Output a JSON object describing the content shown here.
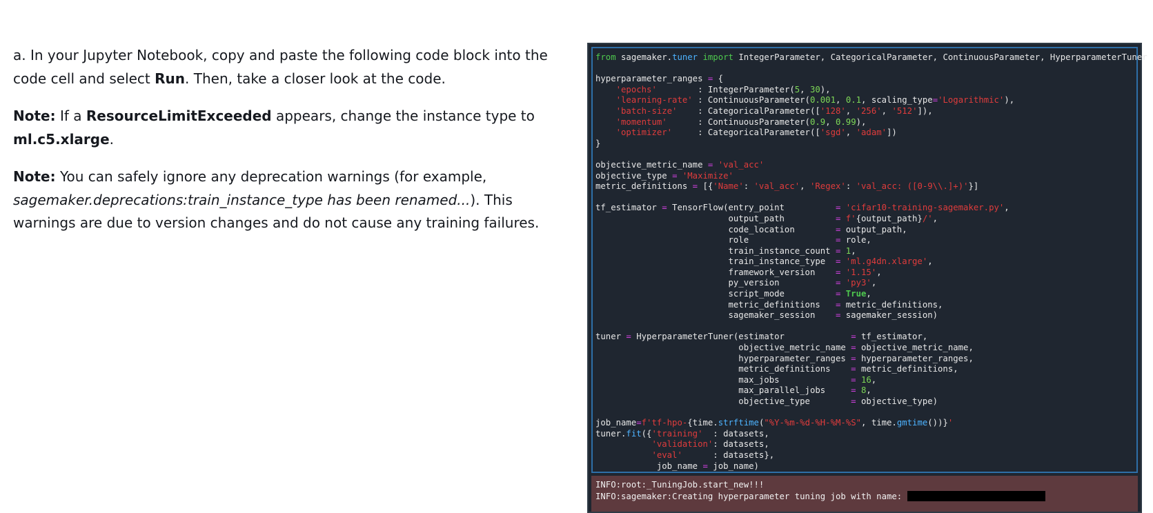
{
  "instructions": {
    "step_a": {
      "prefix": "a. In your Jupyter Notebook, copy and paste the following code block into the code cell and select ",
      "run_label": "Run",
      "suffix": ". Then, take a closer look at the code."
    },
    "note1": {
      "label": "Note:",
      "text1": " If a ",
      "error_name": "ResourceLimitExceeded",
      "text2": " appears, change the instance type to ",
      "instance_type": "ml.c5.xlarge",
      "text3": "."
    },
    "note2": {
      "label": "Note:",
      "text1": " You can safely ignore any deprecation warnings (for example, ",
      "example": "sagemaker.deprecations:train_instance_type has been renamed...",
      "text2": "). This warnings are due to version changes and do not cause any training failures."
    }
  },
  "output": {
    "line1": "INFO:root:_TuningJob.start_new!!!",
    "line2": "INFO:sagemaker:Creating hyperparameter tuning job with name: "
  },
  "colors": {
    "code_background": "#1f2630",
    "cell_border": "#2e6fa8",
    "output_background": "#5e3a3e",
    "keyword": "#4ec94e",
    "string": "#e03c3c",
    "number": "#7ed957",
    "operator": "#d040e0",
    "module": "#4db3ff"
  }
}
